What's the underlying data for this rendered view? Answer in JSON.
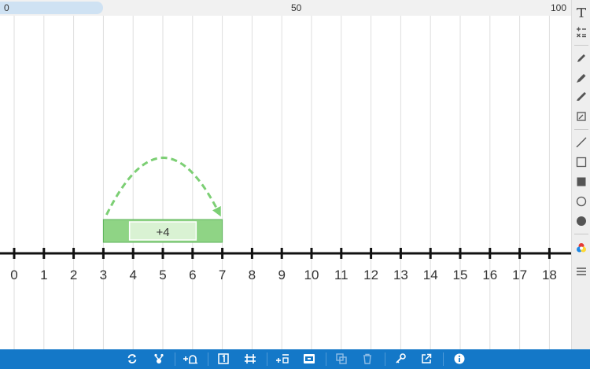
{
  "zoom_bar": {
    "start_label": "0",
    "mid_label": "50",
    "end_label": "100",
    "value_fraction": 0.18
  },
  "number_line": {
    "min": 0,
    "max": 18,
    "tick_labels": [
      "0",
      "1",
      "2",
      "3",
      "4",
      "5",
      "6",
      "7",
      "8",
      "9",
      "10",
      "11",
      "12",
      "13",
      "14",
      "15",
      "16",
      "17",
      "18"
    ]
  },
  "jump": {
    "from": 3,
    "to": 7,
    "label": "+4"
  },
  "colors": {
    "jump_fill": "#8fd485",
    "jump_border": "#5cb35a",
    "jump_label_bg": "#d9f2d3",
    "arrow": "#7ccf74",
    "toolbar_bg": "#1478c8",
    "sidebar_bg": "#eeeeee",
    "grid": "#dedede"
  },
  "sidebar_tools": [
    "text-tool-icon",
    "math-symbols-icon",
    "pen-icon",
    "marker-icon",
    "highlighter-icon",
    "eraser-icon",
    "line-tool-icon",
    "rectangle-outline-icon",
    "rectangle-filled-icon",
    "circle-outline-icon",
    "circle-filled-icon",
    "color-picker-icon",
    "menu-icon"
  ],
  "bottom_tools": [
    "reset-icon",
    "settings-icon",
    "add-jump-icon",
    "single-jump-icon",
    "grid-icon",
    "add-divider-icon",
    "screen-icon",
    "duplicate-icon",
    "trash-icon",
    "key-icon",
    "share-icon",
    "info-icon"
  ]
}
